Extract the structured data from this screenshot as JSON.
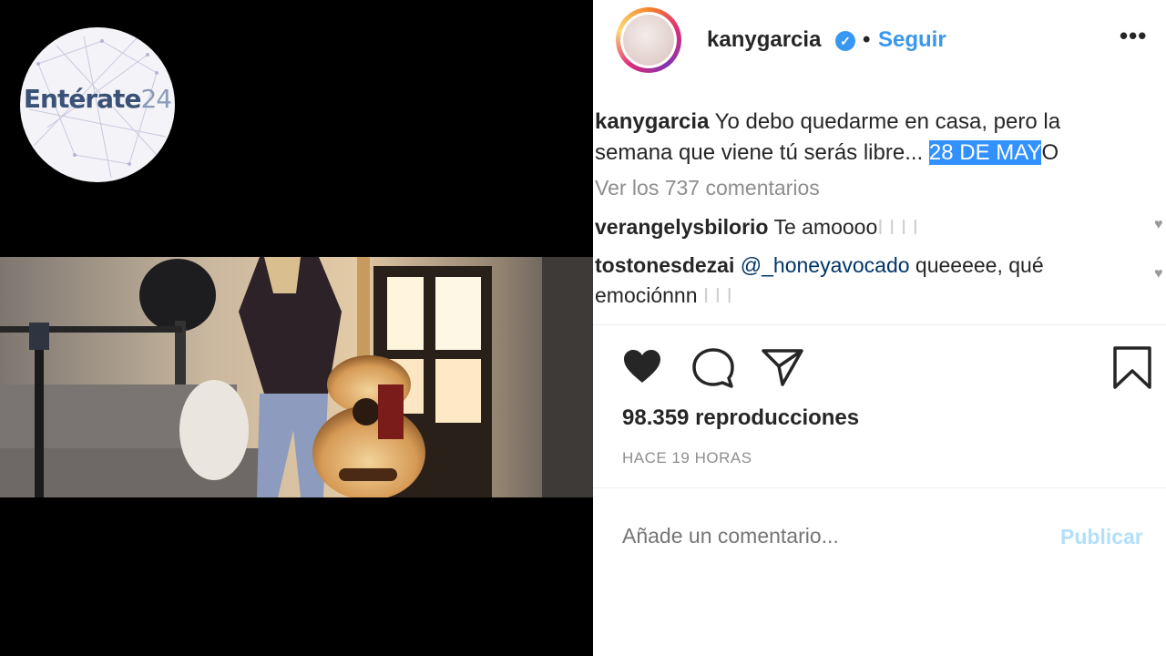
{
  "brand": {
    "name": "Entérate",
    "number": "24"
  },
  "post": {
    "username": "kanygarcia",
    "separator": "•",
    "follow_label": "Seguir",
    "more_label": "•••",
    "caption_user": "kanygarcia",
    "caption_text": "Yo debo quedarme en casa, pero la semana que viene tú serás libre... ",
    "caption_highlight": "28 DE MAY",
    "caption_tail": "O",
    "view_comments": "Ver los 737 comentarios",
    "comments": [
      {
        "user": "verangelysbilorio",
        "text": "Te amoooo",
        "extra": "I I I I"
      },
      {
        "user": "tostonesdezai",
        "mention": "@_honeyavocado",
        "text": "queeeee, qué emociónnn",
        "extra": "I I I"
      }
    ],
    "views": "98.359 reproducciones",
    "time": "HACE 19 HORAS",
    "comment_placeholder": "Añade un comentario...",
    "publish_label": "Publicar"
  },
  "icons": [
    "like-icon",
    "comment-icon",
    "share-icon",
    "save-icon",
    "verified-icon",
    "more-options-icon"
  ],
  "colors": {
    "link": "#3897f0",
    "text": "#262626",
    "muted": "#8e8e8e",
    "highlight": "#3390ff"
  }
}
